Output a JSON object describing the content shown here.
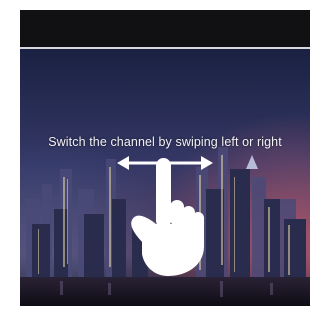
{
  "overlay": {
    "hint_text": "Switch the channel by swiping left or right"
  },
  "icons": {
    "gesture": "swipe-hand-icon",
    "arrows": "left-right-arrow-icon"
  },
  "colors": {
    "top_bar": "#111113",
    "divider": "#d8d8dc",
    "sky_top": "#1a2344",
    "sky_mid": "#3a3c6a",
    "skyline_glow": "#c05a6a",
    "hint_text": "#f2f2f6",
    "hand": "#ffffff"
  }
}
